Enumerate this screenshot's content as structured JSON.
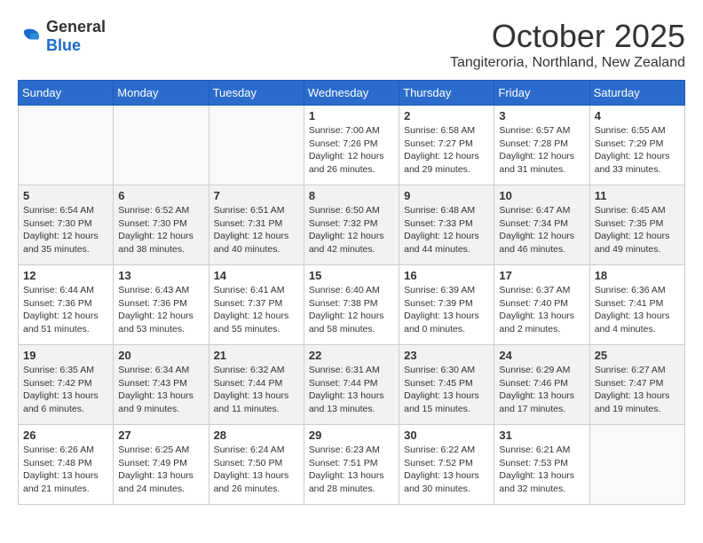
{
  "header": {
    "logo_general": "General",
    "logo_blue": "Blue",
    "month_title": "October 2025",
    "location": "Tangiteroria, Northland, New Zealand"
  },
  "days_of_week": [
    "Sunday",
    "Monday",
    "Tuesday",
    "Wednesday",
    "Thursday",
    "Friday",
    "Saturday"
  ],
  "weeks": [
    [
      {
        "day": "",
        "detail": ""
      },
      {
        "day": "",
        "detail": ""
      },
      {
        "day": "",
        "detail": ""
      },
      {
        "day": "1",
        "detail": "Sunrise: 7:00 AM\nSunset: 7:26 PM\nDaylight: 12 hours\nand 26 minutes."
      },
      {
        "day": "2",
        "detail": "Sunrise: 6:58 AM\nSunset: 7:27 PM\nDaylight: 12 hours\nand 29 minutes."
      },
      {
        "day": "3",
        "detail": "Sunrise: 6:57 AM\nSunset: 7:28 PM\nDaylight: 12 hours\nand 31 minutes."
      },
      {
        "day": "4",
        "detail": "Sunrise: 6:55 AM\nSunset: 7:29 PM\nDaylight: 12 hours\nand 33 minutes."
      }
    ],
    [
      {
        "day": "5",
        "detail": "Sunrise: 6:54 AM\nSunset: 7:30 PM\nDaylight: 12 hours\nand 35 minutes."
      },
      {
        "day": "6",
        "detail": "Sunrise: 6:52 AM\nSunset: 7:30 PM\nDaylight: 12 hours\nand 38 minutes."
      },
      {
        "day": "7",
        "detail": "Sunrise: 6:51 AM\nSunset: 7:31 PM\nDaylight: 12 hours\nand 40 minutes."
      },
      {
        "day": "8",
        "detail": "Sunrise: 6:50 AM\nSunset: 7:32 PM\nDaylight: 12 hours\nand 42 minutes."
      },
      {
        "day": "9",
        "detail": "Sunrise: 6:48 AM\nSunset: 7:33 PM\nDaylight: 12 hours\nand 44 minutes."
      },
      {
        "day": "10",
        "detail": "Sunrise: 6:47 AM\nSunset: 7:34 PM\nDaylight: 12 hours\nand 46 minutes."
      },
      {
        "day": "11",
        "detail": "Sunrise: 6:45 AM\nSunset: 7:35 PM\nDaylight: 12 hours\nand 49 minutes."
      }
    ],
    [
      {
        "day": "12",
        "detail": "Sunrise: 6:44 AM\nSunset: 7:36 PM\nDaylight: 12 hours\nand 51 minutes."
      },
      {
        "day": "13",
        "detail": "Sunrise: 6:43 AM\nSunset: 7:36 PM\nDaylight: 12 hours\nand 53 minutes."
      },
      {
        "day": "14",
        "detail": "Sunrise: 6:41 AM\nSunset: 7:37 PM\nDaylight: 12 hours\nand 55 minutes."
      },
      {
        "day": "15",
        "detail": "Sunrise: 6:40 AM\nSunset: 7:38 PM\nDaylight: 12 hours\nand 58 minutes."
      },
      {
        "day": "16",
        "detail": "Sunrise: 6:39 AM\nSunset: 7:39 PM\nDaylight: 13 hours\nand 0 minutes."
      },
      {
        "day": "17",
        "detail": "Sunrise: 6:37 AM\nSunset: 7:40 PM\nDaylight: 13 hours\nand 2 minutes."
      },
      {
        "day": "18",
        "detail": "Sunrise: 6:36 AM\nSunset: 7:41 PM\nDaylight: 13 hours\nand 4 minutes."
      }
    ],
    [
      {
        "day": "19",
        "detail": "Sunrise: 6:35 AM\nSunset: 7:42 PM\nDaylight: 13 hours\nand 6 minutes."
      },
      {
        "day": "20",
        "detail": "Sunrise: 6:34 AM\nSunset: 7:43 PM\nDaylight: 13 hours\nand 9 minutes."
      },
      {
        "day": "21",
        "detail": "Sunrise: 6:32 AM\nSunset: 7:44 PM\nDaylight: 13 hours\nand 11 minutes."
      },
      {
        "day": "22",
        "detail": "Sunrise: 6:31 AM\nSunset: 7:44 PM\nDaylight: 13 hours\nand 13 minutes."
      },
      {
        "day": "23",
        "detail": "Sunrise: 6:30 AM\nSunset: 7:45 PM\nDaylight: 13 hours\nand 15 minutes."
      },
      {
        "day": "24",
        "detail": "Sunrise: 6:29 AM\nSunset: 7:46 PM\nDaylight: 13 hours\nand 17 minutes."
      },
      {
        "day": "25",
        "detail": "Sunrise: 6:27 AM\nSunset: 7:47 PM\nDaylight: 13 hours\nand 19 minutes."
      }
    ],
    [
      {
        "day": "26",
        "detail": "Sunrise: 6:26 AM\nSunset: 7:48 PM\nDaylight: 13 hours\nand 21 minutes."
      },
      {
        "day": "27",
        "detail": "Sunrise: 6:25 AM\nSunset: 7:49 PM\nDaylight: 13 hours\nand 24 minutes."
      },
      {
        "day": "28",
        "detail": "Sunrise: 6:24 AM\nSunset: 7:50 PM\nDaylight: 13 hours\nand 26 minutes."
      },
      {
        "day": "29",
        "detail": "Sunrise: 6:23 AM\nSunset: 7:51 PM\nDaylight: 13 hours\nand 28 minutes."
      },
      {
        "day": "30",
        "detail": "Sunrise: 6:22 AM\nSunset: 7:52 PM\nDaylight: 13 hours\nand 30 minutes."
      },
      {
        "day": "31",
        "detail": "Sunrise: 6:21 AM\nSunset: 7:53 PM\nDaylight: 13 hours\nand 32 minutes."
      },
      {
        "day": "",
        "detail": ""
      }
    ]
  ]
}
